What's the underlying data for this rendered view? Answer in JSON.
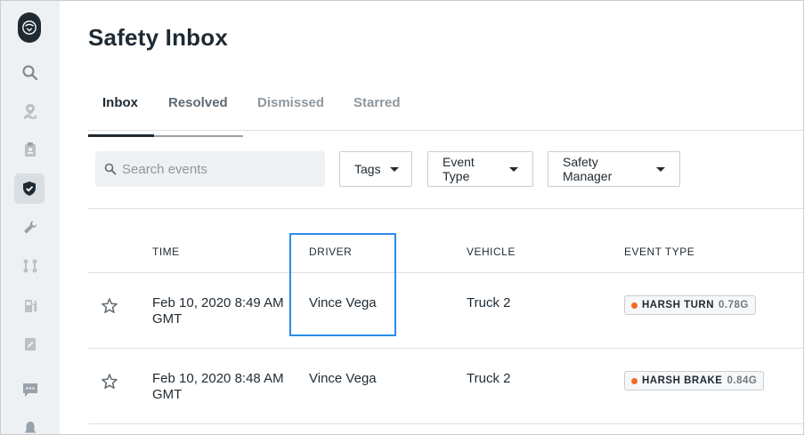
{
  "page": {
    "title": "Safety Inbox"
  },
  "tabs": [
    {
      "label": "Inbox"
    },
    {
      "label": "Resolved"
    },
    {
      "label": "Dismissed"
    },
    {
      "label": "Starred"
    }
  ],
  "search": {
    "placeholder": "Search events"
  },
  "filters": {
    "tags": "Tags",
    "event_type": "Event Type",
    "safety_manager": "Safety Manager"
  },
  "table": {
    "headers": {
      "time": "TIME",
      "driver": "DRIVER",
      "vehicle": "VEHICLE",
      "event_type": "EVENT TYPE"
    },
    "rows": [
      {
        "time": "Feb 10, 2020 8:49 AM GMT",
        "driver": "Vince Vega",
        "vehicle": "Truck 2",
        "event": "HARSH TURN",
        "event_value": "0.78G"
      },
      {
        "time": "Feb 10, 2020 8:48 AM GMT",
        "driver": "Vince Vega",
        "vehicle": "Truck 2",
        "event": "HARSH BRAKE",
        "event_value": "0.84G"
      }
    ]
  },
  "sidebar": {
    "items": [
      {
        "icon": "search-icon"
      },
      {
        "icon": "map-pin-icon"
      },
      {
        "icon": "clipboard-icon"
      },
      {
        "icon": "shield-icon",
        "active": true
      },
      {
        "icon": "wrench-icon"
      },
      {
        "icon": "route-icon"
      },
      {
        "icon": "fuel-icon"
      },
      {
        "icon": "document-icon"
      },
      {
        "icon": "message-icon"
      },
      {
        "icon": "bell-icon"
      }
    ]
  },
  "colors": {
    "accent_highlight": "#2b8ce6",
    "event_dot": "#f26a21",
    "sidebar_bg": "#eef1f3"
  }
}
